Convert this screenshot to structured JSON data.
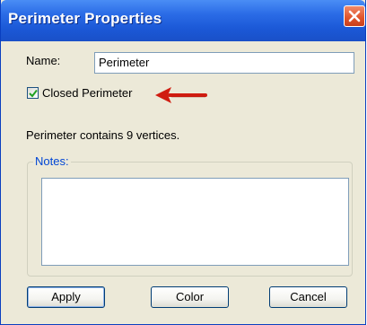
{
  "window": {
    "title": "Perimeter Properties",
    "close_icon": "close-icon"
  },
  "form": {
    "name_label": "Name:",
    "name_value": "Perimeter",
    "closed_label": "Closed Perimeter",
    "closed_checked": true,
    "vertex_info": "Perimeter contains 9 vertices.",
    "notes_label": "Notes:",
    "notes_value": ""
  },
  "buttons": {
    "apply": "Apply",
    "color": "Color",
    "cancel": "Cancel"
  },
  "colors": {
    "title_bar": "#1b58d6",
    "accent_arrow": "#d01c10",
    "group_label": "#0046d5"
  },
  "icons": {
    "annotation_arrow": "red-arrow-icon",
    "check": "checkmark-icon"
  }
}
